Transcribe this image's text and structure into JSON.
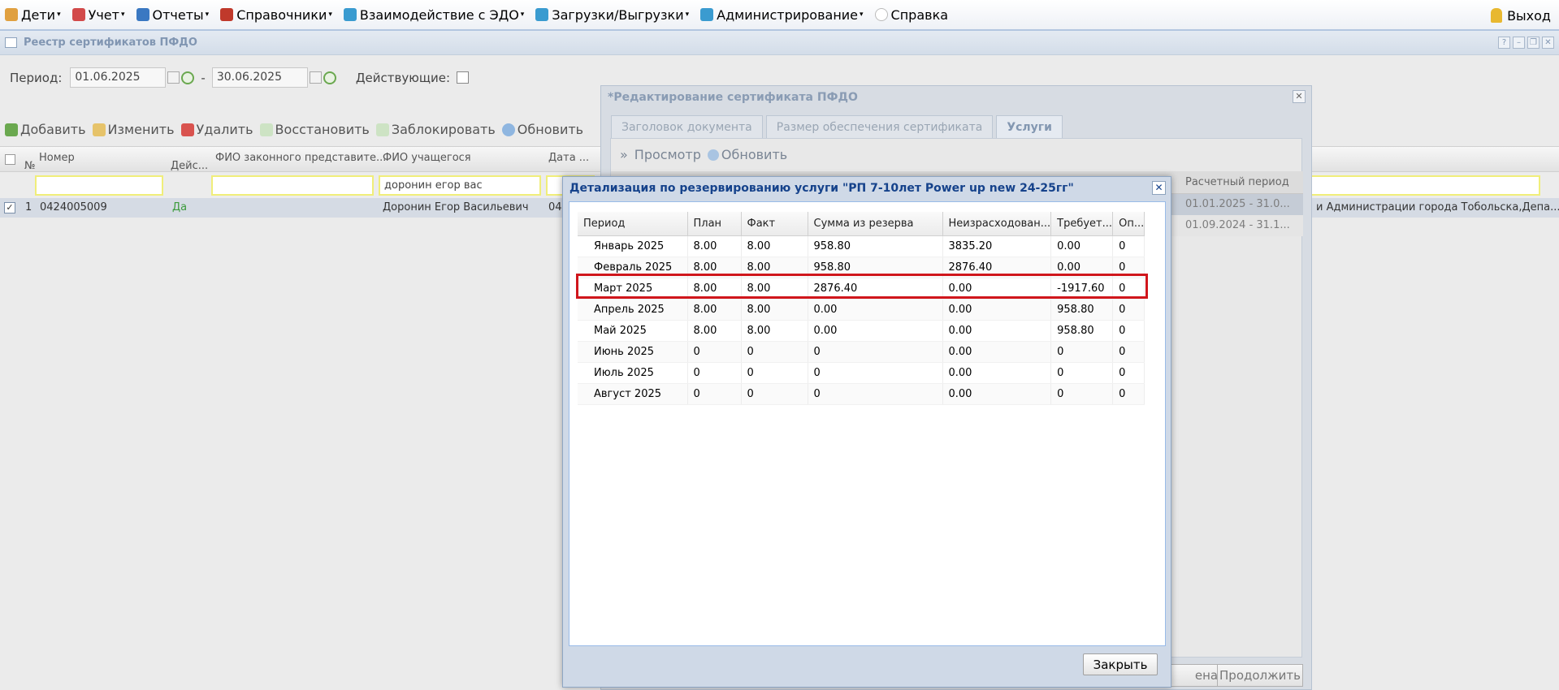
{
  "menu": {
    "items": [
      {
        "label": "Дети",
        "icon": "children-icon",
        "color": "#e0a040",
        "caret": true
      },
      {
        "label": "Учет",
        "icon": "books-icon",
        "color": "#d24a4a",
        "caret": true
      },
      {
        "label": "Отчеты",
        "icon": "reports-icon",
        "color": "#3a78c2",
        "caret": true
      },
      {
        "label": "Справочники",
        "icon": "directory-icon",
        "color": "#c0392b",
        "caret": true
      },
      {
        "label": "Взаимодействие с ЭДО",
        "icon": "gears-icon",
        "color": "#3a9bd0",
        "caret": true
      },
      {
        "label": "Загрузки/Выгрузки",
        "icon": "gears-icon",
        "color": "#3a9bd0",
        "caret": true
      },
      {
        "label": "Администрирование",
        "icon": "gears-icon",
        "color": "#3a9bd0",
        "caret": true
      },
      {
        "label": "Справка",
        "icon": "help-icon",
        "color": "#bbbbbb",
        "caret": false
      }
    ],
    "exit_label": "Выход"
  },
  "registry": {
    "title": "Реестр сертификатов ПФДО",
    "period_label": "Период:",
    "date_from": "01.06.2025",
    "date_sep": "-",
    "date_to": "30.06.2025",
    "active_label": "Действующие:",
    "toolbar": {
      "add": "Добавить",
      "edit": "Изменить",
      "delete": "Удалить",
      "restore": "Восстановить",
      "block": "Заблокировать",
      "refresh": "Обновить"
    },
    "columns": {
      "num": "№",
      "number": "Номер",
      "active": "Дейс...",
      "guardian": "ФИО законного представите...",
      "student": "ФИО учащегося",
      "date": "Дата ..."
    },
    "filters": {
      "student": "доронин егор вас"
    },
    "row": {
      "index": "1",
      "number": "0424005009",
      "active": "Да",
      "student": "Доронин Егор Васильевич",
      "date": "04",
      "org": "и Администрации города Тобольска,Депа..."
    }
  },
  "edit_window": {
    "title": "*Редактирование сертификата ПФДО",
    "tabs": [
      "Заголовок документа",
      "Размер обеспечения сертификата",
      "Услуги"
    ],
    "active_tab": 2,
    "view_label": "Просмотр",
    "refresh_label": "Обновить",
    "period_column": "Расчетный период",
    "rows": [
      "01.01.2025 - 31.0...",
      "01.09.2024 - 31.1..."
    ],
    "cancel_label": "ена",
    "continue_label": "Продолжить"
  },
  "dialog": {
    "title": "Детализация по резервированию услуги \"РП 7-10лет Power up new 24-25гг\"",
    "columns": [
      "Период",
      "План",
      "Факт",
      "Сумма из резерва",
      "Неизрасходован...",
      "Требует...",
      "Оп..."
    ],
    "rows": [
      [
        "Январь 2025",
        "8.00",
        "8.00",
        "958.80",
        "3835.20",
        "0.00",
        "0"
      ],
      [
        "Февраль 2025",
        "8.00",
        "8.00",
        "958.80",
        "2876.40",
        "0.00",
        "0"
      ],
      [
        "Март 2025",
        "8.00",
        "8.00",
        "2876.40",
        "0.00",
        "-1917.60",
        "0"
      ],
      [
        "Апрель 2025",
        "8.00",
        "8.00",
        "0.00",
        "0.00",
        "958.80",
        "0"
      ],
      [
        "Май 2025",
        "8.00",
        "8.00",
        "0.00",
        "0.00",
        "958.80",
        "0"
      ],
      [
        "Июнь 2025",
        "0",
        "0",
        "0",
        "0.00",
        "0",
        "0"
      ],
      [
        "Июль 2025",
        "0",
        "0",
        "0",
        "0.00",
        "0",
        "0"
      ],
      [
        "Август 2025",
        "0",
        "0",
        "0",
        "0.00",
        "0",
        "0"
      ]
    ],
    "highlighted_row": 2,
    "highlight_color": "#d0161c",
    "close_label": "Закрыть"
  }
}
